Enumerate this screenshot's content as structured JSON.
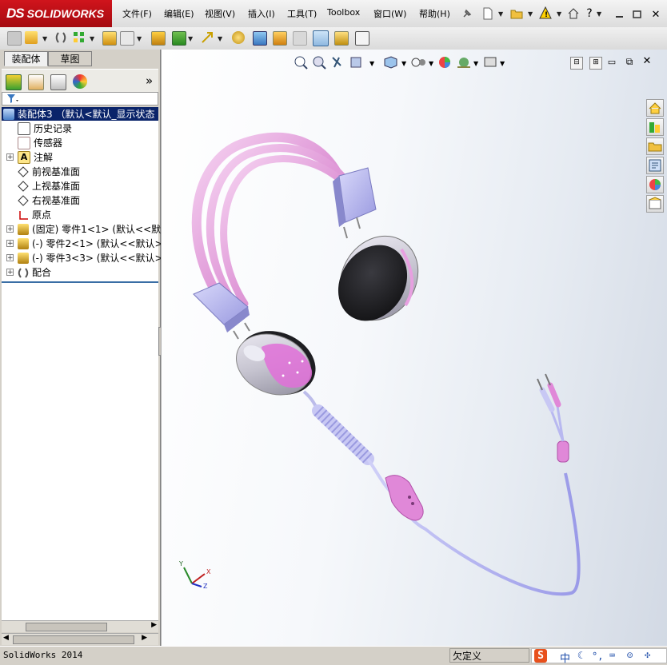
{
  "app": {
    "logo_text": "SOLIDWORKS",
    "logo_ds": "DS"
  },
  "menu": [
    "文件(F)",
    "编辑(E)",
    "视图(V)",
    "插入(I)",
    "工具(T)",
    "Toolbox",
    "窗口(W)",
    "帮助(H)"
  ],
  "panel": {
    "tabs": [
      "装配体",
      "草图"
    ],
    "filter_icon": "filter-icon",
    "expand_glyph": "»",
    "tree": [
      {
        "label": "装配体3 （默认<默认_显示状态",
        "icon": "assembly-icon",
        "selected": true
      },
      {
        "label": "历史记录",
        "icon": "history-icon"
      },
      {
        "label": "传感器",
        "icon": "sensor-icon"
      },
      {
        "label": "注解",
        "icon": "annotation-icon",
        "expander": "+"
      },
      {
        "label": "前视基准面",
        "icon": "plane-icon"
      },
      {
        "label": "上视基准面",
        "icon": "plane-icon"
      },
      {
        "label": "右视基准面",
        "icon": "plane-icon"
      },
      {
        "label": "原点",
        "icon": "origin-icon"
      },
      {
        "label": "(固定) 零件1<1> (默认<<默认",
        "icon": "part-icon",
        "expander": "+"
      },
      {
        "label": "(-) 零件2<1> (默认<<默认>_",
        "icon": "part-icon",
        "expander": "+"
      },
      {
        "label": "(-) 零件3<3> (默认<<默认>_",
        "icon": "part-icon",
        "expander": "+"
      },
      {
        "label": "配合",
        "icon": "mate-icon",
        "expander": "+"
      }
    ]
  },
  "status": {
    "app_name": "SolidWorks 2014",
    "state": "欠定义"
  },
  "ime": {
    "logo": "S",
    "lang": "中"
  },
  "colors": {
    "brand_red": "#c8101a",
    "selection": "#0a246a",
    "headband_pink": "#e8a0e0",
    "slider_lavender": "#b8b8f0",
    "earcup_dark": "#2a2a2e"
  }
}
